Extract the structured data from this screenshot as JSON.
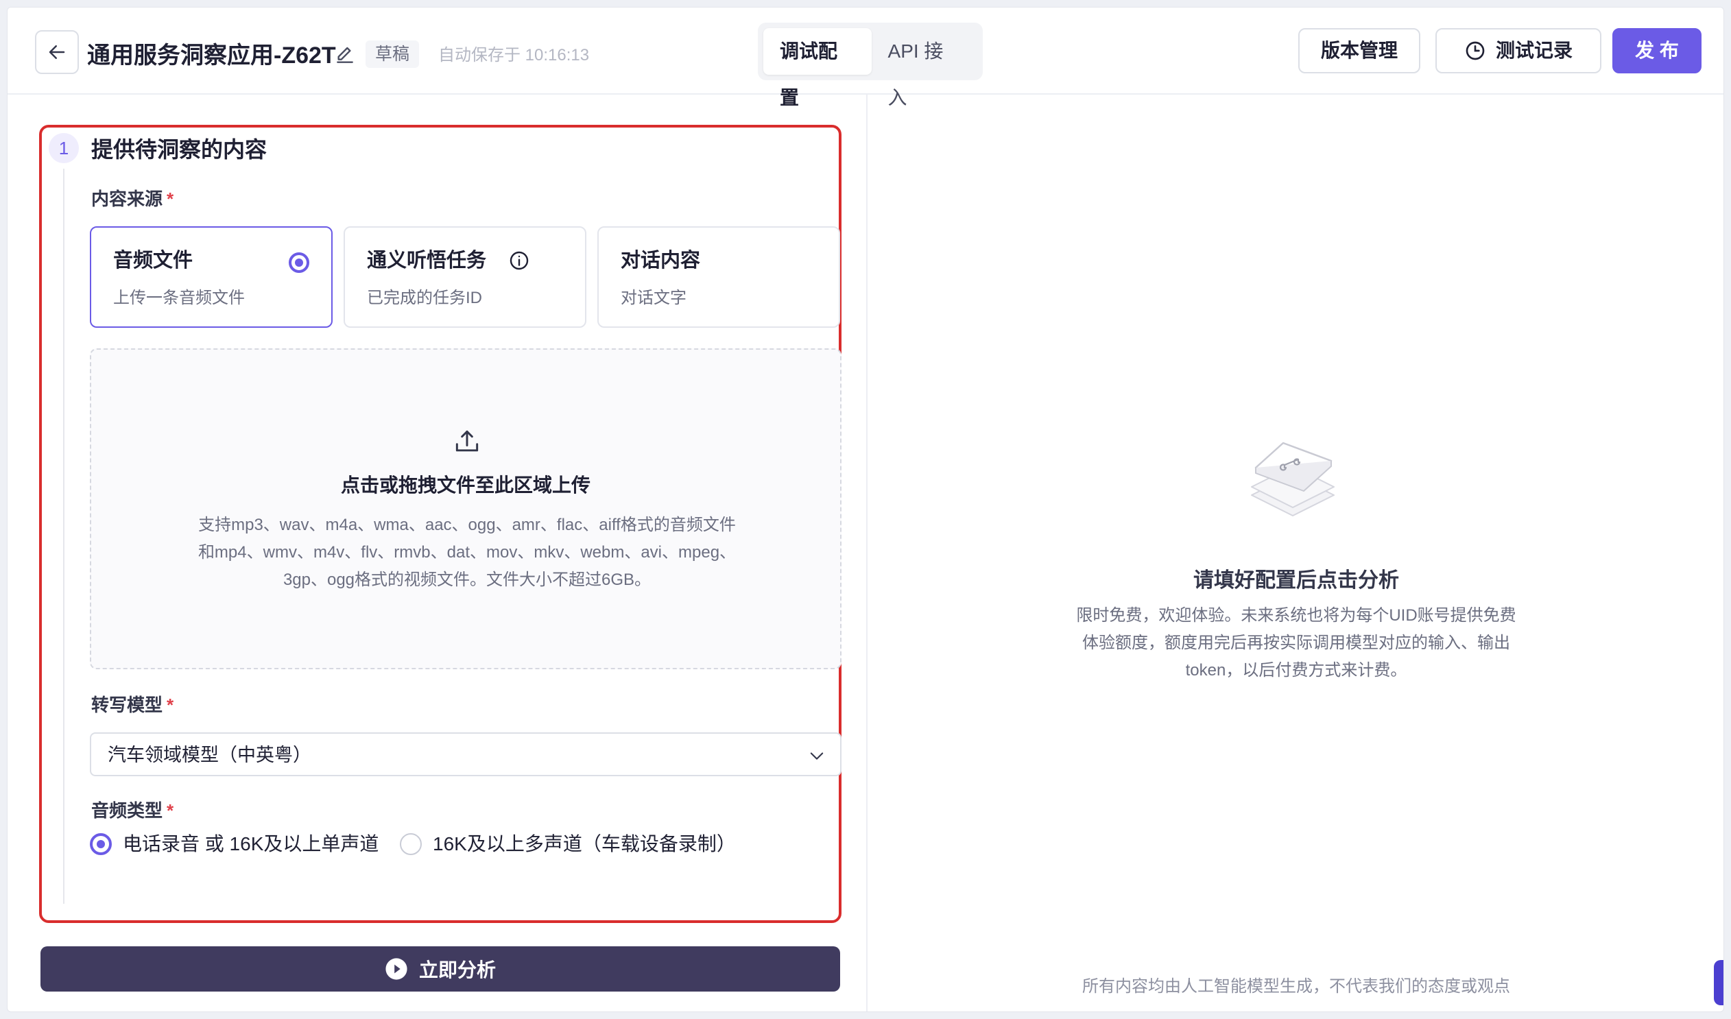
{
  "header": {
    "title": "通用服务洞察应用-Z62T",
    "draft_badge": "草稿",
    "autosave_text": "自动保存于 10:16:13",
    "tabs": [
      {
        "label": "调试配置",
        "active": true
      },
      {
        "label": "API 接入",
        "active": false
      }
    ],
    "version_button": "版本管理",
    "records_button": "测试记录",
    "publish_button": "发 布"
  },
  "step": {
    "number": "1",
    "title": "提供待洞察的内容"
  },
  "content_source": {
    "label": "内容来源",
    "required_mark": "*",
    "options": [
      {
        "title": "音频文件",
        "subtitle": "上传一条音频文件",
        "selected": true
      },
      {
        "title": "通义听悟任务",
        "subtitle": "已完成的任务ID",
        "selected": false
      },
      {
        "title": "对话内容",
        "subtitle": "对话文字",
        "selected": false
      }
    ]
  },
  "upload": {
    "title": "点击或拖拽文件至此区域上传",
    "description": "支持mp3、wav、m4a、wma、aac、ogg、amr、flac、aiff格式的音频文件和mp4、wmv、m4v、flv、rmvb、dat、mov、mkv、webm、avi、mpeg、3gp、ogg格式的视频文件。文件大小不超过6GB。"
  },
  "transcription_model": {
    "label": "转写模型",
    "required_mark": "*",
    "value": "汽车领域模型（中英粤）"
  },
  "audio_type": {
    "label": "音频类型",
    "required_mark": "*",
    "options": [
      {
        "label": "电话录音 或 16K及以上单声道",
        "selected": true
      },
      {
        "label": "16K及以上多声道（车载设备录制）",
        "selected": false
      }
    ]
  },
  "analyze_button": "立即分析",
  "empty_state": {
    "title": "请填好配置后点击分析",
    "description": "限时免费，欢迎体验。未来系统也将为每个UID账号提供免费体验额度，额度用完后再按实际调用模型对应的输入、输出token，以后付费方式来计费。"
  },
  "footer_note": "所有内容均由人工智能模型生成，不代表我们的态度或观点",
  "colors": {
    "accent": "#6b5be6",
    "highlight_border": "#d92d2d",
    "analyze_button_bg": "#403b5f"
  }
}
